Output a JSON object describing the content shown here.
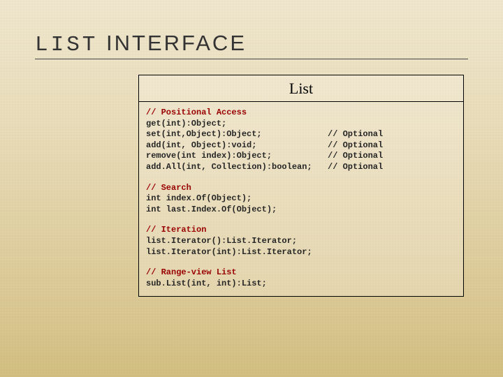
{
  "title": {
    "mono": "LIST",
    "rest": " INTERFACE"
  },
  "box": {
    "header": "List",
    "sections": {
      "positional": {
        "heading": "// Positional Access",
        "r1l": "get(int):Object;",
        "r2l": "set(int,Object):Object;",
        "r2r": "// Optional",
        "r3l": "add(int, Object):void;",
        "r3r": "// Optional",
        "r4l": "remove(int index):Object;",
        "r4r": "// Optional",
        "r5l": "add.All(int, Collection):boolean;",
        "r5r": "// Optional"
      },
      "search": {
        "heading": "// Search",
        "r1": "int index.Of(Object);",
        "r2": "int last.Index.Of(Object);"
      },
      "iteration": {
        "heading": "// Iteration",
        "r1": "list.Iterator():List.Iterator;",
        "r2": "list.Iterator(int):List.Iterator;"
      },
      "range": {
        "heading": "// Range-view List",
        "r1": "sub.List(int, int):List;"
      }
    }
  }
}
